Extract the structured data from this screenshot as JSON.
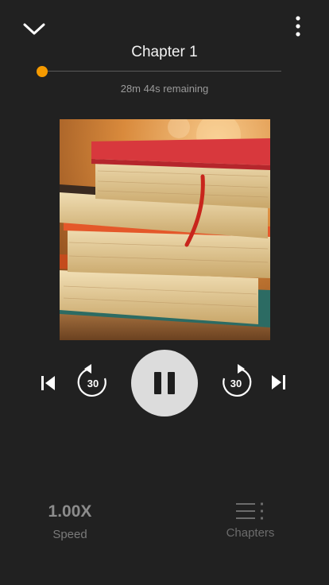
{
  "header": {
    "collapse_icon": "chevron-down-icon",
    "more_icon": "more-vertical-icon",
    "chapter_title": "Chapter 1"
  },
  "progress": {
    "fraction": 0.0,
    "remaining_text": "28m 44s remaining",
    "accent_color": "#f59a00"
  },
  "cover": {
    "description_icon": "book-stack-cover"
  },
  "controls": {
    "previous_icon": "skip-previous-icon",
    "rewind_icon": "rewind-30-icon",
    "rewind_seconds": "30",
    "play_pause_icon": "pause-icon",
    "forward_icon": "forward-30-icon",
    "forward_seconds": "30",
    "next_icon": "skip-next-icon"
  },
  "bottom": {
    "speed_value": "1.00X",
    "speed_label": "Speed",
    "chapters_icon": "chapter-list-icon",
    "chapters_label": "Chapters"
  }
}
